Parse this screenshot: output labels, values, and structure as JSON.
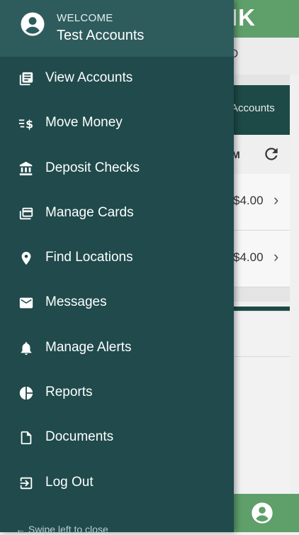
{
  "background_app": {
    "brand_fragment": "IK",
    "sub_fragment": "D",
    "tab_fragment": "Accounts",
    "column_fragment": "M",
    "rows": [
      {
        "amount": "$4.00"
      },
      {
        "amount": "$4.00"
      }
    ],
    "colors": {
      "brand_green": "#5e9f6a",
      "dark_teal": "#1d4a46"
    }
  },
  "drawer": {
    "welcome": "WELCOME",
    "user_name": "Test Accounts",
    "items": [
      {
        "label": "View Accounts",
        "icon": "accounts-list-icon"
      },
      {
        "label": "Move Money",
        "icon": "transfer-money-icon"
      },
      {
        "label": "Deposit Checks",
        "icon": "bank-icon"
      },
      {
        "label": "Manage Cards",
        "icon": "cards-icon"
      },
      {
        "label": "Find Locations",
        "icon": "location-pin-icon"
      },
      {
        "label": "Messages",
        "icon": "envelope-icon"
      },
      {
        "label": "Manage Alerts",
        "icon": "bell-icon"
      },
      {
        "label": "Reports",
        "icon": "pie-chart-icon"
      },
      {
        "label": "Documents",
        "icon": "document-icon"
      },
      {
        "label": "Log Out",
        "icon": "logout-icon"
      }
    ],
    "swipe_hint": "Swipe left to close",
    "colors": {
      "drawer_bg": "#204a4b",
      "header_bg": "#2e5c5d"
    }
  }
}
